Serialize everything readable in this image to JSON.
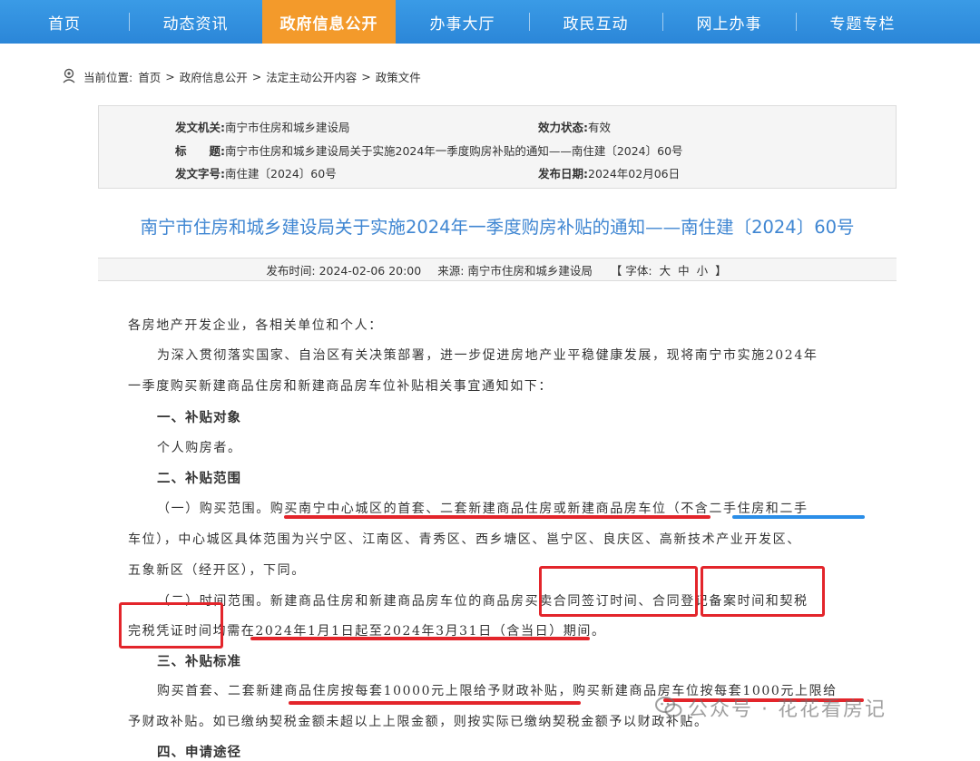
{
  "nav": {
    "items": [
      "首页",
      "动态资讯",
      "政府信息公开",
      "办事大厅",
      "政民互动",
      "网上办事",
      "专题专栏"
    ],
    "active_index": 2
  },
  "breadcrumb": {
    "label": "当前位置:",
    "items": [
      "首页",
      "政府信息公开",
      "法定主动公开内容",
      "政策文件"
    ]
  },
  "info": {
    "issuer_key": "发文机关:",
    "issuer": "南宁市住房和城乡建设局",
    "status_key": "效力状态:",
    "status": "有效",
    "title_key": "标　　题:",
    "title": "南宁市住房和城乡建设局关于实施2024年一季度购房补贴的通知——南住建〔2024〕60号",
    "docno_key": "发文字号:",
    "docno": "南住建〔2024〕60号",
    "date_key": "发布日期:",
    "date": "2024年02月06日"
  },
  "doc": {
    "title": "南宁市住房和城乡建设局关于实施2024年一季度购房补贴的通知——南住建〔2024〕60号",
    "publish_time": "发布时间: 2024-02-06 20:00",
    "source": "来源: 南宁市住房和城乡建设局",
    "font_label": "【 字体:",
    "font_sizes": [
      "大",
      "中",
      "小"
    ],
    "font_end": "】"
  },
  "body": {
    "l1": "各房地产开发企业，各相关单位和个人：",
    "l2": "为深入贯彻落实国家、自治区有关决策部署，进一步促进房地产业平稳健康发展，现将南宁市实施2024年",
    "l3": "一季度购买新建商品住房和新建商品房车位补贴相关事宜通知如下：",
    "h1": "一、补贴对象",
    "l4": "个人购房者。",
    "h2": "二、补贴范围",
    "l5": "（一）购买范围。购买南宁中心城区的首套、二套新建商品住房或新建商品房车位（不含二手住房和二手",
    "l6": "车位），中心城区具体范围为兴宁区、江南区、青秀区、西乡塘区、邕宁区、良庆区、高新技术产业开发区、",
    "l7": "五象新区（经开区），下同。",
    "l8": "（二）时间范围。新建商品住房和新建商品房车位的商品房买卖合同签订时间、合同登记备案时间和契税",
    "l9": "完税凭证时间均需在2024年1月1日起至2024年3月31日（含当日）期间。",
    "h3": "三、补贴标准",
    "l10": "购买首套、二套新建商品住房按每套10000元上限给予财政补贴，购买新建商品房车位按每套1000元上限给",
    "l11": "予财政补贴。如已缴纳契税金额未超以上上限金额，则按实际已缴纳契税金额予以财政补贴。",
    "h4": "四、申请途径"
  },
  "watermark": "公众号 · 花花看房记",
  "colors": {
    "nav_blue": "#2b86d8",
    "nav_active": "#f39a2b",
    "title_blue": "#3f86d2",
    "mark_red": "#e3252b",
    "mark_blue": "#2a8ee8"
  }
}
